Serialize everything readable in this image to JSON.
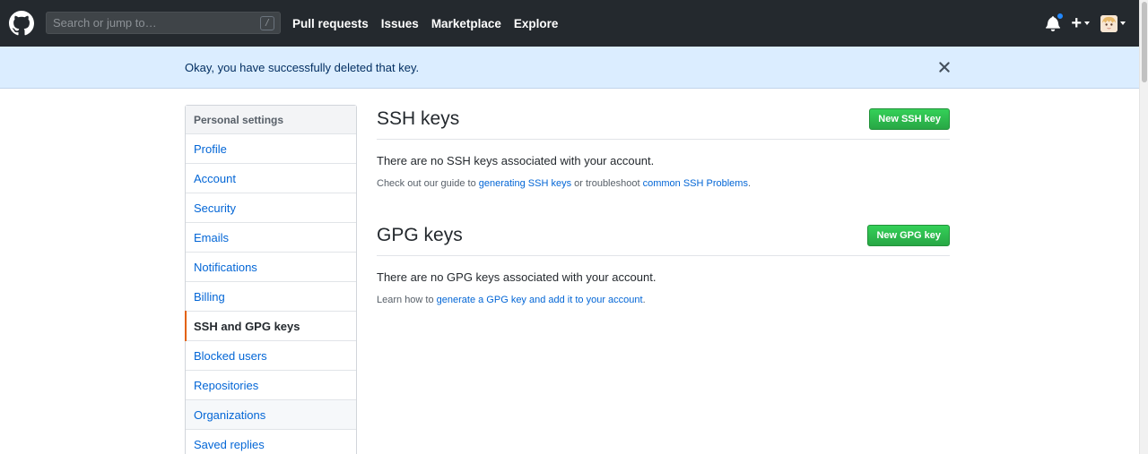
{
  "header": {
    "search_placeholder": "Search or jump to…",
    "search_shortcut": "/",
    "nav": [
      "Pull requests",
      "Issues",
      "Marketplace",
      "Explore"
    ],
    "plus_label": "+"
  },
  "flash": {
    "message": "Okay, you have successfully deleted that key."
  },
  "sidebar": {
    "heading": "Personal settings",
    "items": [
      {
        "label": "Profile"
      },
      {
        "label": "Account"
      },
      {
        "label": "Security"
      },
      {
        "label": "Emails"
      },
      {
        "label": "Notifications"
      },
      {
        "label": "Billing"
      },
      {
        "label": "SSH and GPG keys",
        "selected": true
      },
      {
        "label": "Blocked users"
      },
      {
        "label": "Repositories"
      },
      {
        "label": "Organizations"
      },
      {
        "label": "Saved replies"
      }
    ]
  },
  "ssh": {
    "title": "SSH keys",
    "button": "New SSH key",
    "empty": "There are no SSH keys associated with your account.",
    "note_prefix": "Check out our guide to ",
    "link1": "generating SSH keys",
    "note_middle": " or troubleshoot ",
    "link2": "common SSH Problems",
    "note_suffix": "."
  },
  "gpg": {
    "title": "GPG keys",
    "button": "New GPG key",
    "empty": "There are no GPG keys associated with your account.",
    "note_prefix": "Learn how to ",
    "link1": "generate a GPG key and add it to your account",
    "note_suffix": "."
  },
  "colors": {
    "header_bg": "#24292e",
    "flash_bg": "#dbedff",
    "link": "#0366d6",
    "button_green": "#28a745",
    "selected_accent": "#e36209"
  }
}
